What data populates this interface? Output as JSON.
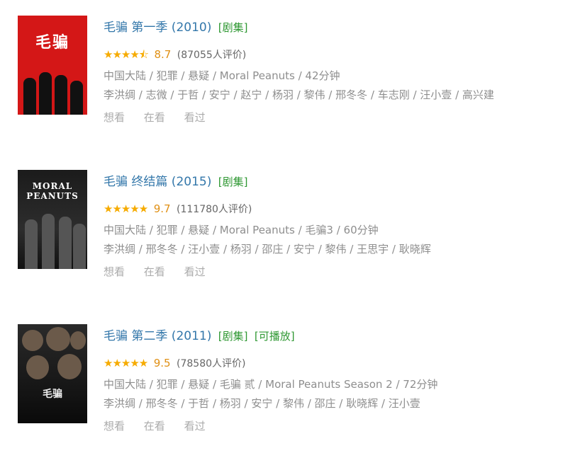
{
  "items": [
    {
      "title": "毛骗 第一季 (2010)",
      "tags": [
        "[剧集]"
      ],
      "stars": "★★★★⯪",
      "score": "8.7",
      "votes": "(87055人评价)",
      "meta": "中国大陆 / 犯罪 / 悬疑 / Moral Peanuts / 42分钟",
      "cast": "李洪绸 / 志微 / 于哲 / 安宁 / 赵宁 / 杨羽 / 黎伟 / 邢冬冬 / 车志刚 / 汪小壹 / 高兴建",
      "actions": [
        "想看",
        "在看",
        "看过"
      ],
      "poster_text": "毛骗"
    },
    {
      "title": "毛骗 终结篇 (2015)",
      "tags": [
        "[剧集]"
      ],
      "stars": "★★★★★",
      "score": "9.7",
      "votes": "(111780人评价)",
      "meta": "中国大陆 / 犯罪 / 悬疑 / Moral Peanuts / 毛骗3 / 60分钟",
      "cast": "李洪绸 / 邢冬冬 / 汪小壹 / 杨羽 / 邵庄 / 安宁 / 黎伟 / 王思宇 / 耿晓辉",
      "actions": [
        "想看",
        "在看",
        "看过"
      ],
      "poster_text": "MORAL PEANUTS"
    },
    {
      "title": "毛骗 第二季 (2011)",
      "tags": [
        "[剧集]",
        "[可播放]"
      ],
      "stars": "★★★★★",
      "score": "9.5",
      "votes": "(78580人评价)",
      "meta": "中国大陆 / 犯罪 / 悬疑 / 毛骗 贰 / Moral Peanuts Season 2 / 72分钟",
      "cast": "李洪绸 / 邢冬冬 / 于哲 / 杨羽 / 安宁 / 黎伟 / 邵庄 / 耿晓辉 / 汪小壹",
      "actions": [
        "想看",
        "在看",
        "看过"
      ],
      "poster_text": "毛骗"
    }
  ],
  "colors": {
    "title": "#3377aa",
    "tag": "#2f9833",
    "star": "#f6ab00",
    "meta": "#8e8e8e",
    "action": "#aaaaaa"
  }
}
